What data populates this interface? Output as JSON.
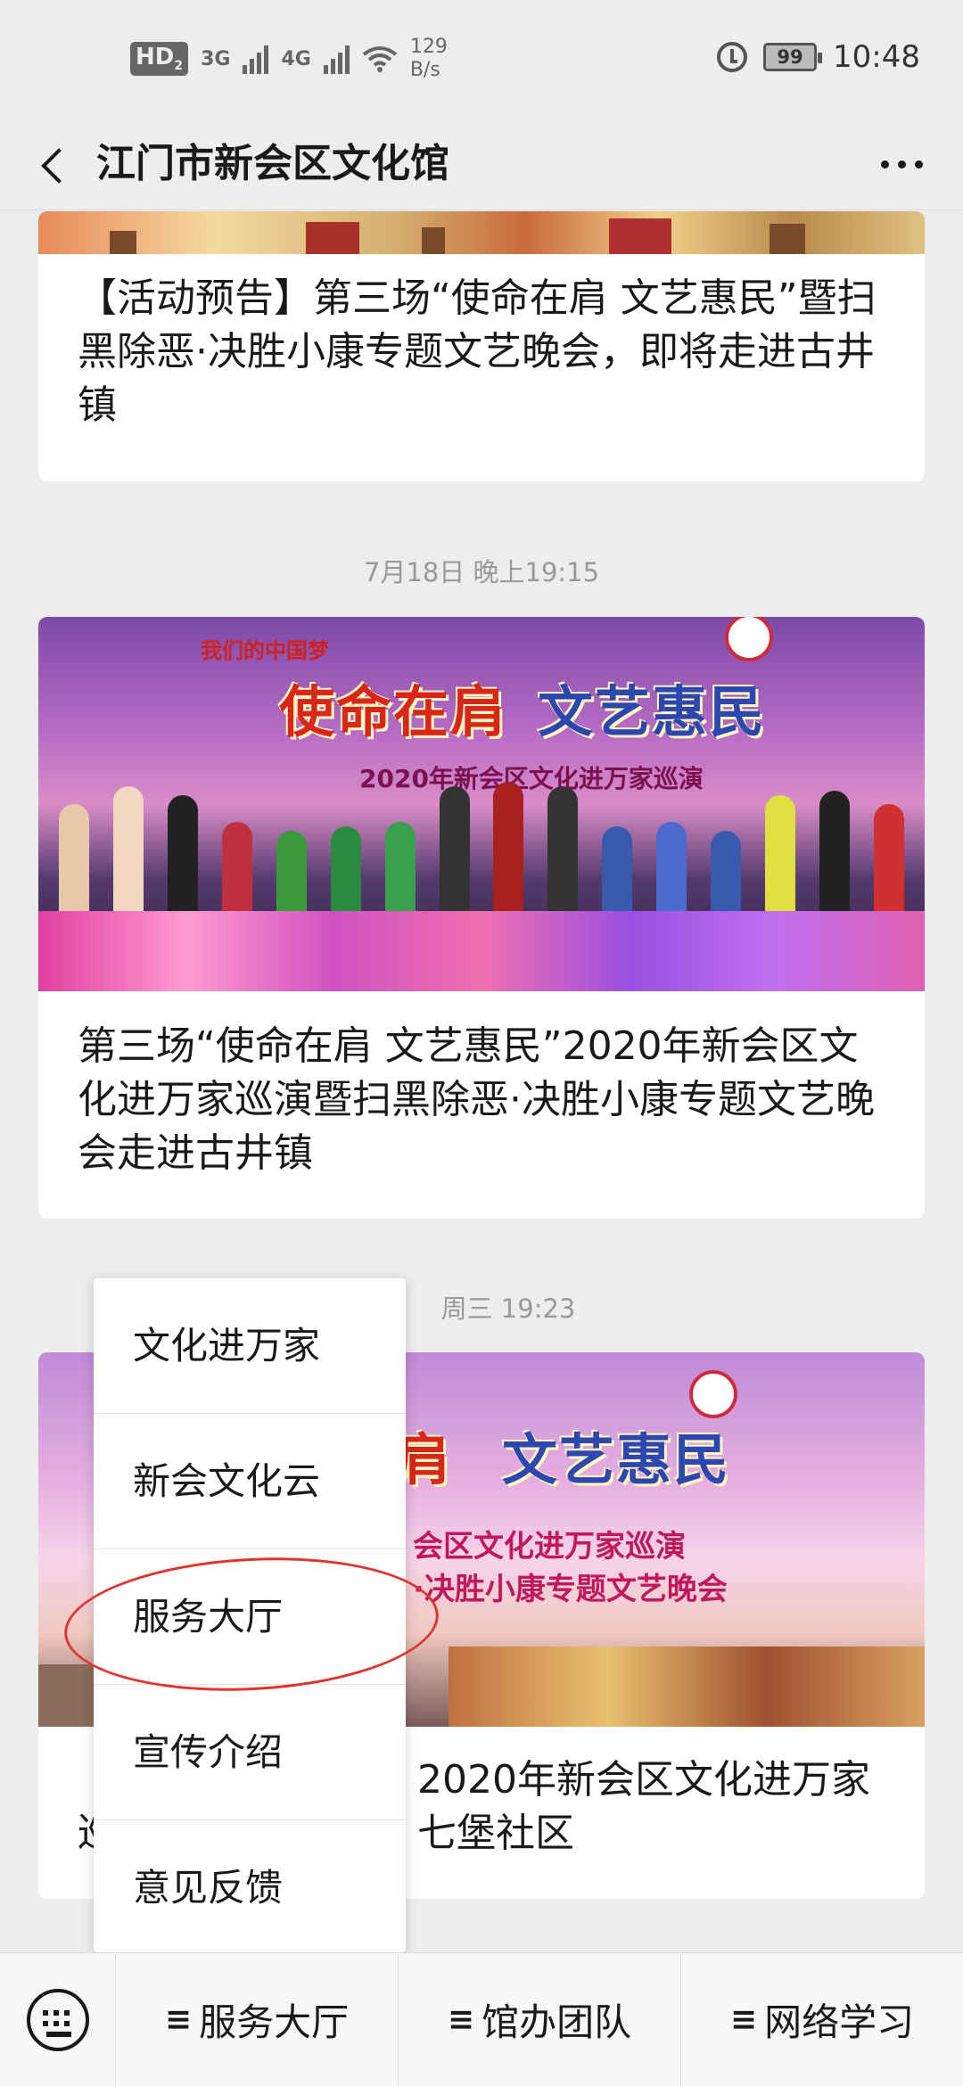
{
  "status_bar": {
    "hd_badge": "HD",
    "hd_sub": "2",
    "signal1_label": "3G",
    "signal2_label": "4G",
    "speed_value": "129",
    "speed_unit": "B/s",
    "battery": "99",
    "time": "10:48"
  },
  "nav": {
    "title": "江门市新会区文化馆"
  },
  "feed": {
    "card1": {
      "title": "【活动预告】第三场“使命在肩 文艺惠民”暨扫黑除恶·决胜小康专题文艺晚会，即将走进古井镇"
    },
    "time2": "7月18日 晚上19:15",
    "card2": {
      "banner_top_left": "我们的中国梦",
      "banner_slogan_a": "使命在肩",
      "banner_slogan_b": "文艺惠民",
      "banner_sub": "2020年新会区文化进万家巡演",
      "title": "第三场“使命在肩 文艺惠民”2020年新会区文化进万家巡演暨扫黑除恶·决胜小康专题文艺晚会走进古井镇"
    },
    "time3": "周三 19:23",
    "card3": {
      "banner_slogan_a": "肩",
      "banner_slogan_b": "文艺惠民",
      "banner_sub1": "会区文化进万家巡演",
      "banner_sub2": "·决胜小康专题文艺晚会",
      "title_visible_prefix": "【",
      "title_visible_line1": "2020年新会区文化进万家",
      "title_visible_line2_prefix": "巡",
      "title_visible_line2": "七堡社区"
    }
  },
  "popup_menu": {
    "items": [
      "文化进万家",
      "新会文化云",
      "服务大厅",
      "宣传介绍",
      "意见反馈"
    ]
  },
  "bottom_bar": {
    "menu_icon": "≡",
    "items": [
      "服务大厅",
      "馆办团队",
      "网络学习"
    ]
  },
  "colors": {
    "background": "#ededed",
    "annotation_circle": "#e0342c",
    "slogan_red": "#d8261b",
    "slogan_blue": "#2c48b0"
  }
}
